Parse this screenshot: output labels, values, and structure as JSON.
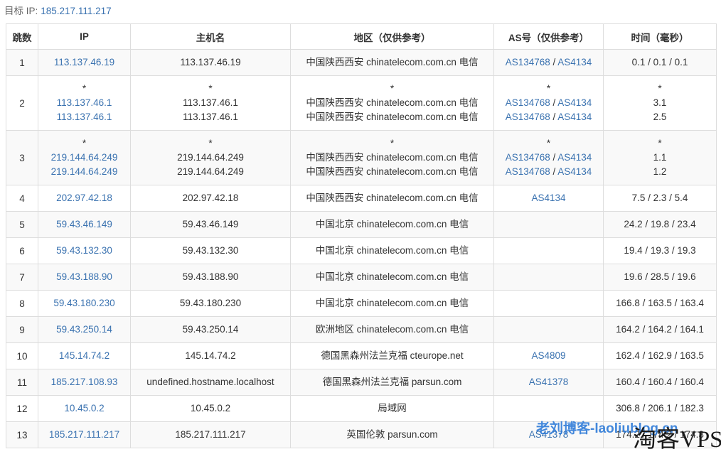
{
  "target": {
    "label": "目标 IP:",
    "ip": "185.217.111.217"
  },
  "columns": [
    "跳数",
    "IP",
    "主机名",
    "地区（仅供参考）",
    "AS号（仅供参考）",
    "时间（毫秒）"
  ],
  "hops": [
    {
      "hop": "1",
      "lines": [
        {
          "ip": "113.137.46.19",
          "host": "113.137.46.19",
          "region": "中国陕西西安 chinatelecom.com.cn 电信",
          "as": [
            "AS134768",
            "AS4134"
          ],
          "time": "0.1 / 0.1 / 0.1"
        }
      ]
    },
    {
      "hop": "2",
      "lines": [
        {
          "ip": "*",
          "host": "*",
          "region": "*",
          "as": [
            "*"
          ],
          "time": "*"
        },
        {
          "ip": "113.137.46.1",
          "host": "113.137.46.1",
          "region": "中国陕西西安 chinatelecom.com.cn 电信",
          "as": [
            "AS134768",
            "AS4134"
          ],
          "time": "3.1"
        },
        {
          "ip": "113.137.46.1",
          "host": "113.137.46.1",
          "region": "中国陕西西安 chinatelecom.com.cn 电信",
          "as": [
            "AS134768",
            "AS4134"
          ],
          "time": "2.5"
        }
      ]
    },
    {
      "hop": "3",
      "lines": [
        {
          "ip": "*",
          "host": "*",
          "region": "*",
          "as": [
            "*"
          ],
          "time": "*"
        },
        {
          "ip": "219.144.64.249",
          "host": "219.144.64.249",
          "region": "中国陕西西安 chinatelecom.com.cn 电信",
          "as": [
            "AS134768",
            "AS4134"
          ],
          "time": "1.1"
        },
        {
          "ip": "219.144.64.249",
          "host": "219.144.64.249",
          "region": "中国陕西西安 chinatelecom.com.cn 电信",
          "as": [
            "AS134768",
            "AS4134"
          ],
          "time": "1.2"
        }
      ]
    },
    {
      "hop": "4",
      "lines": [
        {
          "ip": "202.97.42.18",
          "host": "202.97.42.18",
          "region": "中国陕西西安 chinatelecom.com.cn 电信",
          "as": [
            "AS4134"
          ],
          "time": "7.5 / 2.3 / 5.4"
        }
      ]
    },
    {
      "hop": "5",
      "lines": [
        {
          "ip": "59.43.46.149",
          "host": "59.43.46.149",
          "region": "中国北京 chinatelecom.com.cn 电信",
          "as": [],
          "time": "24.2 / 19.8 / 23.4"
        }
      ]
    },
    {
      "hop": "6",
      "lines": [
        {
          "ip": "59.43.132.30",
          "host": "59.43.132.30",
          "region": "中国北京 chinatelecom.com.cn 电信",
          "as": [],
          "time": "19.4 / 19.3 / 19.3"
        }
      ]
    },
    {
      "hop": "7",
      "lines": [
        {
          "ip": "59.43.188.90",
          "host": "59.43.188.90",
          "region": "中国北京 chinatelecom.com.cn 电信",
          "as": [],
          "time": "19.6 / 28.5 / 19.6"
        }
      ]
    },
    {
      "hop": "8",
      "lines": [
        {
          "ip": "59.43.180.230",
          "host": "59.43.180.230",
          "region": "中国北京 chinatelecom.com.cn 电信",
          "as": [],
          "time": "166.8 / 163.5 / 163.4"
        }
      ]
    },
    {
      "hop": "9",
      "lines": [
        {
          "ip": "59.43.250.14",
          "host": "59.43.250.14",
          "region": "欧洲地区 chinatelecom.com.cn 电信",
          "as": [],
          "time": "164.2 / 164.2 / 164.1"
        }
      ]
    },
    {
      "hop": "10",
      "lines": [
        {
          "ip": "145.14.74.2",
          "host": "145.14.74.2",
          "region": "德国黑森州法兰克福 cteurope.net",
          "as": [
            "AS4809"
          ],
          "time": "162.4 / 162.9 / 163.5"
        }
      ]
    },
    {
      "hop": "11",
      "lines": [
        {
          "ip": "185.217.108.93",
          "host": "undefined.hostname.localhost",
          "region": "德国黑森州法兰克福 parsun.com",
          "as": [
            "AS41378"
          ],
          "time": "160.4 / 160.4 / 160.4"
        }
      ]
    },
    {
      "hop": "12",
      "lines": [
        {
          "ip": "10.45.0.2",
          "host": "10.45.0.2",
          "region": "局域网",
          "as": [],
          "time": "306.8 / 206.1 / 182.3"
        }
      ]
    },
    {
      "hop": "13",
      "lines": [
        {
          "ip": "185.217.111.217",
          "host": "185.217.111.217",
          "region": "英国伦敦 parsun.com",
          "as": [
            "AS41378"
          ],
          "time": "174.2 / 174.2 / 174.3"
        }
      ]
    }
  ],
  "watermarks": {
    "blog": "老刘博客-laoliublog.cn",
    "site": "淘客VPS"
  },
  "colors": {
    "link": "#3a72b0",
    "border": "#dddddd",
    "stripe": "#f9f9f9"
  }
}
